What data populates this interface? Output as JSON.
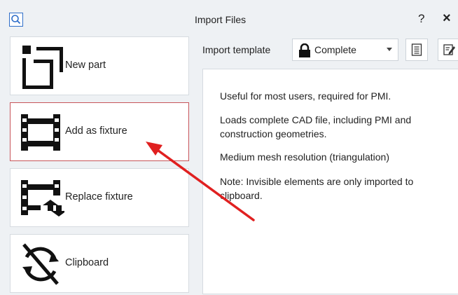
{
  "window": {
    "title": "Import Files",
    "help_label": "?",
    "close_label": "×"
  },
  "actions": [
    {
      "label": "New part",
      "icon": "new-part-icon"
    },
    {
      "label": "Add as fixture",
      "icon": "fixture-icon",
      "selected": true
    },
    {
      "label": "Replace fixture",
      "icon": "replace-fixture-icon"
    },
    {
      "label": "Clipboard",
      "icon": "clipboard-sync-icon"
    }
  ],
  "template": {
    "label": "Import template",
    "value": "Complete"
  },
  "description": {
    "line1": "Useful for most users, required for PMI.",
    "line2": "Loads complete CAD file, including PMI and construction geometries.",
    "line3": "Medium mesh resolution (triangulation)",
    "line4": "Note: Invisible elements are only imported to clipboard."
  },
  "colors": {
    "accent": "#2f6ec9",
    "selected_border": "#c8555a",
    "annotation_arrow": "#e02020"
  }
}
